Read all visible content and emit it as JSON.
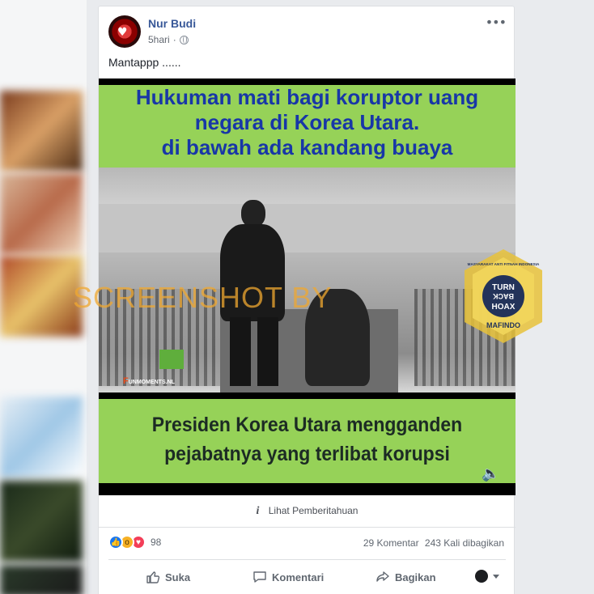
{
  "post": {
    "author": "Nur Budi",
    "time": "5hari",
    "separator": "·",
    "more_glyph": "•••",
    "caption": "Mantappp ......"
  },
  "video": {
    "top_text_lines": [
      "Hukuman mati bagi koruptor uang",
      "negara di Korea Utara.",
      "di bawah ada kandang buaya"
    ],
    "bottom_text_lines": [
      "Presiden Korea Utara mengganden",
      "pejabatnya yang terlibat korupsi"
    ],
    "channel_logo": "F",
    "channel_logo_rest": "UNMOMENTS.NL",
    "speaker_icon": "speaker-icon"
  },
  "watermark": {
    "text": "SCREENSHOT BY",
    "badge_ring_text": "MASYARAKAT ANTI FITNAH INDONESIA",
    "badge_center_lines": [
      "TURN",
      "BACK",
      "HOAX"
    ],
    "badge_bottom_text": "MAFINDO",
    "color": "#f0a830"
  },
  "footer": {
    "notice_label": "Lihat Pemberitahuan",
    "reaction_count": "98",
    "comments": "29 Komentar",
    "shares": "243 Kali dibagikan",
    "actions": {
      "like": "Suka",
      "comment": "Komentari",
      "share": "Bagikan"
    }
  },
  "colors": {
    "author_link": "#385898",
    "caption_green": "#96d258",
    "top_text": "#1837a7"
  }
}
